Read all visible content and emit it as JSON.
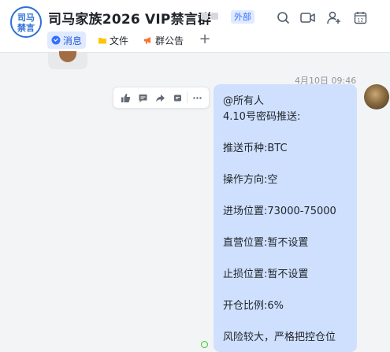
{
  "header": {
    "group_avatar_line1": "司马",
    "group_avatar_line2": "禁言",
    "title": "司马家族2026 VIP禁言群",
    "external_tag": "外部",
    "icons": [
      "search-icon",
      "video-call-icon",
      "add-member-icon",
      "calendar-icon"
    ],
    "calendar_day": "12",
    "tabs": [
      {
        "label": "消息",
        "icon": "chat-bubble-icon",
        "active": true
      },
      {
        "label": "文件",
        "icon": "folder-icon",
        "active": false
      },
      {
        "label": "群公告",
        "icon": "megaphone-icon",
        "active": false
      }
    ],
    "add_tab_label": "+"
  },
  "chat": {
    "timestamp": "4月10日 09:46",
    "toolbar_icons": [
      "thumbs-up-icon",
      "reply-comment-icon",
      "forward-icon",
      "pin-icon",
      "more-icon"
    ],
    "message_lines": [
      "@所有人",
      "4.10号密码推送:",
      "",
      "推送币种:BTC",
      "",
      "操作方向:空",
      "",
      "进场位置:73000-75000",
      "",
      "直营位置:暂不设置",
      "",
      "止损位置:暂不设置",
      "",
      "开仓比例:6%",
      "",
      "风险较大，严格把控仓位"
    ]
  },
  "colors": {
    "accent": "#3370ff",
    "bubble": "#cfe0fe",
    "background": "#f3f4f6",
    "read_indicator": "#34c724"
  }
}
